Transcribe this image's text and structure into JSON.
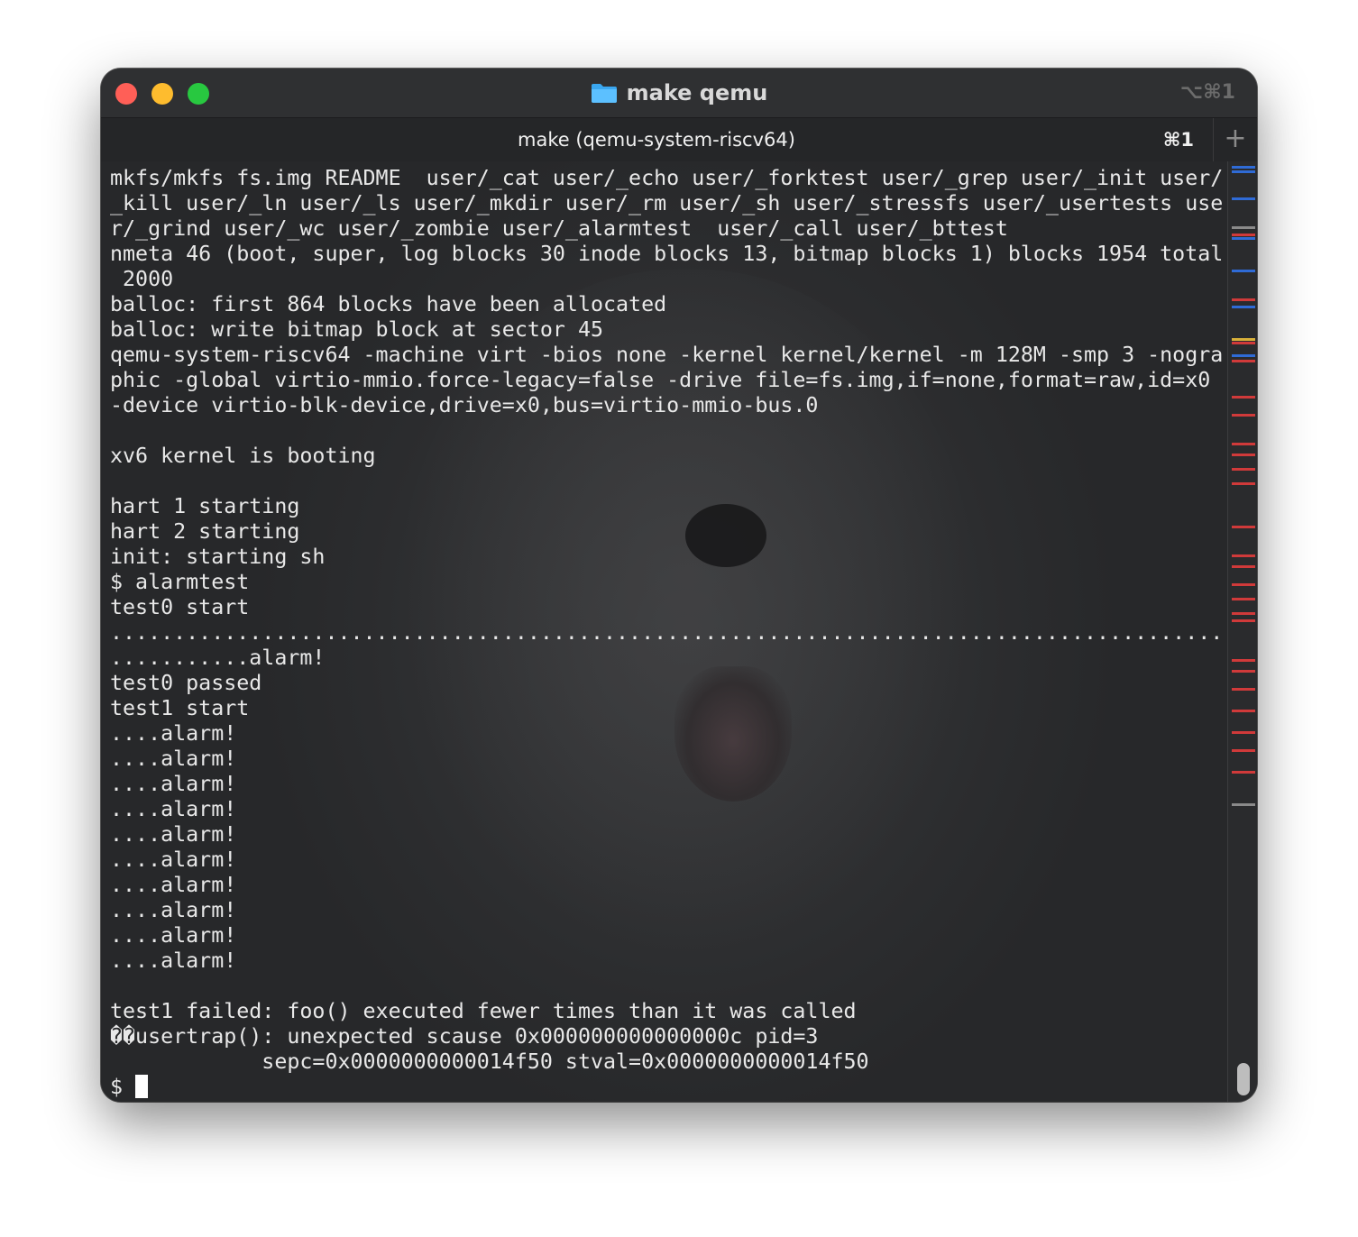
{
  "window": {
    "title": "make qemu",
    "title_shortcut": "⌥⌘1"
  },
  "tab": {
    "label": "make (qemu-system-riscv64)",
    "shortcut": "⌘1",
    "new_tab_symbol": "+"
  },
  "colors": {
    "close": "#ff5f57",
    "minimize": "#febc2e",
    "maximize": "#28c840",
    "folder_icon": "#3aa7f0",
    "mark_blue": "#2f6bd6",
    "mark_red": "#d03a3a",
    "mark_gray": "#8a8a8a",
    "mark_yellow": "#d8b13a"
  },
  "icons": {
    "title_icon": "folder-icon",
    "new_tab": "plus-icon"
  },
  "terminal": {
    "lines": [
      "mkfs/mkfs fs.img README  user/_cat user/_echo user/_forktest user/_grep user/_init user/",
      "_kill user/_ln user/_ls user/_mkdir user/_rm user/_sh user/_stressfs user/_usertests use",
      "r/_grind user/_wc user/_zombie user/_alarmtest  user/_call user/_bttest",
      "nmeta 46 (boot, super, log blocks 30 inode blocks 13, bitmap blocks 1) blocks 1954 total",
      " 2000",
      "balloc: first 864 blocks have been allocated",
      "balloc: write bitmap block at sector 45",
      "qemu-system-riscv64 -machine virt -bios none -kernel kernel/kernel -m 128M -smp 3 -nogra",
      "phic -global virtio-mmio.force-legacy=false -drive file=fs.img,if=none,format=raw,id=x0",
      "-device virtio-blk-device,drive=x0,bus=virtio-mmio-bus.0",
      "",
      "xv6 kernel is booting",
      "",
      "hart 1 starting",
      "hart 2 starting",
      "init: starting sh",
      "$ alarmtest",
      "test0 start",
      "........................................................................................",
      "...........alarm!",
      "test0 passed",
      "test1 start",
      "....alarm!",
      "....alarm!",
      "....alarm!",
      "....alarm!",
      "....alarm!",
      "....alarm!",
      "....alarm!",
      "....alarm!",
      "....alarm!",
      "....alarm!",
      "",
      "test1 failed: foo() executed fewer times than it was called",
      "��usertrap(): unexpected scause 0x000000000000000c pid=3",
      "            sepc=0x0000000000014f50 stval=0x0000000000014f50"
    ],
    "prompt": "$ "
  }
}
